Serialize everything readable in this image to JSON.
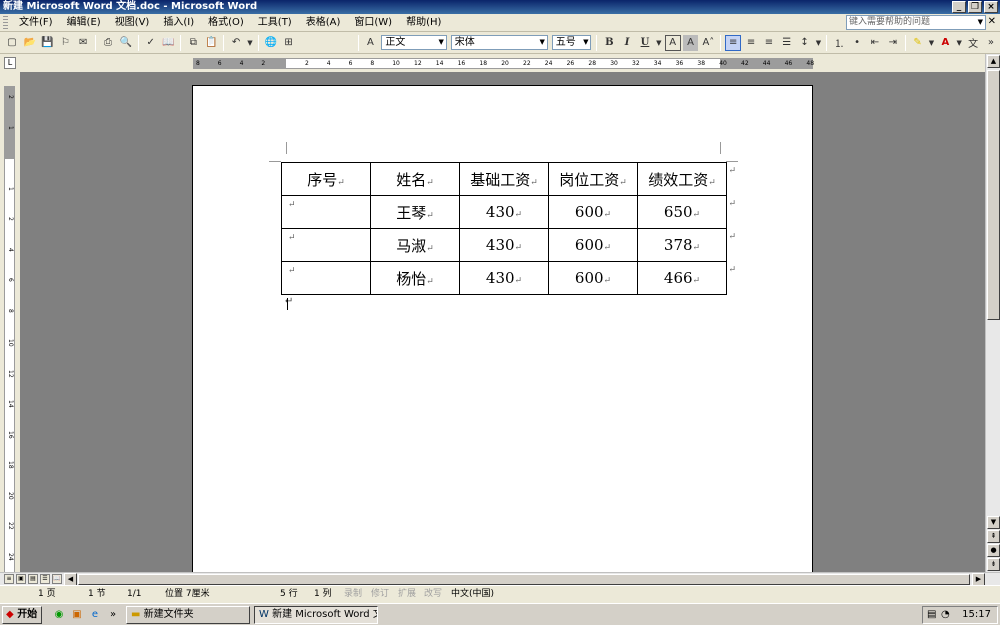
{
  "window": {
    "title": "新建 Microsoft Word 文档.doc - Microsoft Word"
  },
  "menubar": {
    "items": [
      "文件(F)",
      "编辑(E)",
      "视图(V)",
      "插入(I)",
      "格式(O)",
      "工具(T)",
      "表格(A)",
      "窗口(W)",
      "帮助(H)"
    ],
    "help_placeholder": "键入需要帮助的问题"
  },
  "toolbar": {
    "style": "正文",
    "font": "宋体",
    "size": "五号",
    "bold": "B",
    "italic": "I",
    "underline": "U"
  },
  "ruler": {
    "h_ticks": [
      "8",
      "6",
      "4",
      "2",
      "",
      "2",
      "4",
      "6",
      "8",
      "10",
      "12",
      "14",
      "16",
      "18",
      "20",
      "22",
      "24",
      "26",
      "28",
      "30",
      "32",
      "34",
      "36",
      "38",
      "40",
      "42",
      "44",
      "46",
      "48"
    ],
    "v_ticks": [
      "2",
      "1",
      "",
      "1",
      "2",
      "4",
      "6",
      "8",
      "10",
      "12",
      "14",
      "16",
      "18",
      "20",
      "22",
      "24"
    ]
  },
  "table": {
    "headers": [
      "序号",
      "姓名",
      "基础工资",
      "岗位工资",
      "绩效工资"
    ],
    "rows": [
      [
        "",
        "王琴",
        "430",
        "600",
        "650"
      ],
      [
        "",
        "马淑",
        "430",
        "600",
        "378"
      ],
      [
        "",
        "杨怡",
        "430",
        "600",
        "466"
      ]
    ]
  },
  "statusbar": {
    "page": "1 页",
    "section": "1 节",
    "page_of": "1/1",
    "position": "位置 7厘米",
    "line": "5 行",
    "column": "1 列",
    "rec": "录制",
    "trk": "修订",
    "ext": "扩展",
    "ovr": "改写",
    "language": "中文(中国)"
  },
  "taskbar": {
    "start": "开始",
    "tasks": [
      "新建文件夹",
      "新建 Microsoft Word 文..."
    ],
    "clock": "15:17"
  }
}
